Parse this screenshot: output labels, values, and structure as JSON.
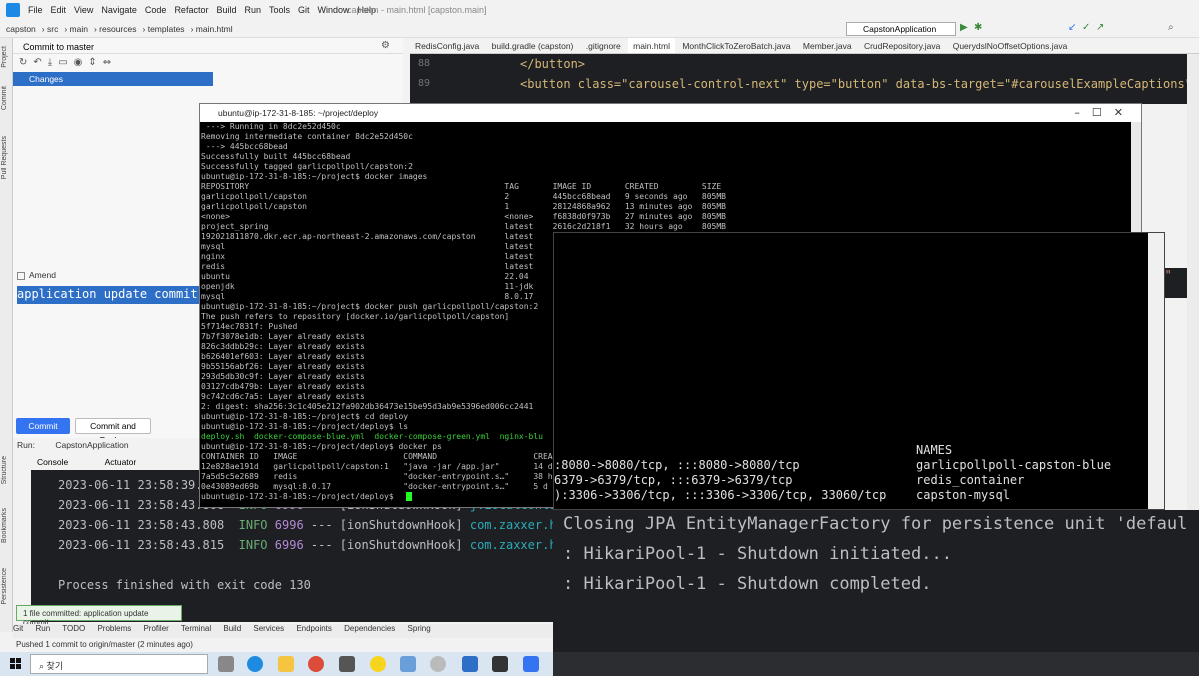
{
  "ide": {
    "menu": [
      "File",
      "Edit",
      "View",
      "Navigate",
      "Code",
      "Refactor",
      "Build",
      "Run",
      "Tools",
      "Git",
      "Window",
      "Help"
    ],
    "title": "capston - main.html [capston.main]",
    "breadcrumb": [
      "capston",
      "src",
      "main",
      "resources",
      "templates",
      "main.html"
    ],
    "run_config": "CapstonApplication",
    "commit_header": "Commit to master",
    "changes_label": "Changes",
    "amend_label": "Amend",
    "commit_message": "application update commit",
    "commit_button": "Commit",
    "commit_push_button": "Commit and Push...",
    "left_tools": [
      "Project",
      "Commit",
      "Pull Requests",
      "Structure",
      "Bookmarks",
      "Persistence"
    ],
    "tabs": [
      "RedisConfig.java",
      "build.gradle (capston)",
      ".gitignore",
      "main.html",
      "MonthClickToZeroBatch.java",
      "Member.java",
      "CrudRepository.java",
      "QuerydslNoOffsetOptions.java"
    ],
    "active_tab": "main.html",
    "editor_lines": [
      {
        "num": "88",
        "code": "</button>"
      },
      {
        "num": "89",
        "code": "<button class=\"carousel-control-next\" type=\"button\" data-bs-target=\"#carouselExampleCaptions\" dat"
      }
    ],
    "editor_right_fragment": "l}\"",
    "run_label": "Run:",
    "run_tab": "CapstonApplication",
    "console_tab": "Console",
    "actuator_tab": "Actuator",
    "console_lines": [
      {
        "ts": "2023-06-11 23:58:39.5",
        "level": "",
        "pid": "",
        "rest": ""
      },
      {
        "ts": "2023-06-11 23:58:43.806",
        "level": "INFO",
        "pid": "6996",
        "rest": " --- [ionShutdownHook] ",
        "cls": "j.LocalContaine"
      },
      {
        "ts": "2023-06-11 23:58:43.808",
        "level": "INFO",
        "pid": "6996",
        "rest": " --- [ionShutdownHook] ",
        "cls": "com.zaxxer.hika"
      },
      {
        "ts": "2023-06-11 23:58:43.815",
        "level": "INFO",
        "pid": "6996",
        "rest": " --- [ionShutdownHook] ",
        "cls": "com.zaxxer.hika"
      }
    ],
    "process_finished": "Process finished with exit code 130",
    "tool_tabs": [
      "Git",
      "Run",
      "TODO",
      "Problems",
      "Profiler",
      "Terminal",
      "Build",
      "Services",
      "Endpoints",
      "Dependencies",
      "Spring"
    ],
    "tooltip": "1 file committed: application update commit",
    "status": "Pushed 1 commit to origin/master (2 minutes ago)",
    "big_lines": [
      "Closing JPA EntityManagerFactory for persistence unit 'defaul",
      ": HikariPool-1 - Shutdown initiated...",
      ": HikariPool-1 - Shutdown completed."
    ]
  },
  "putty": {
    "title": "ubuntu@ip-172-31-8-185: ~/project/deploy",
    "lines": [
      " ---> Running in 8dc2e52d450c",
      "Removing intermediate container 8dc2e52d450c",
      " ---> 445bcc68bead",
      "Successfully built 445bcc68bead",
      "Successfully tagged garlicpollpoll/capston:2",
      "ubuntu@ip-172-31-8-185:~/project$ docker images",
      "REPOSITORY                                                     TAG       IMAGE ID       CREATED         SIZE",
      "garlicpollpoll/capston                                         2         445bcc68bead   9 seconds ago   805MB",
      "garlicpollpoll/capston                                         1         28124868a962   13 minutes ago  805MB",
      "<none>                                                         <none>    f6838d0f973b   27 minutes ago  805MB",
      "project_spring                                                 latest    2616c2d218f1   32 hours ago    805MB",
      "192021811870.dkr.ecr.ap-northeast-2.amazonaws.com/capston      latest    c",
      "mysql                                                          latest    c",
      "nginx                                                          latest    i",
      "redis                                                          latest    i",
      "ubuntu                                                         22.04     3",
      "openjdk                                                        11-jdk    c",
      "mysql                                                          8.0.17    i",
      "ubuntu@ip-172-31-8-185:~/project$ docker push garlicpollpoll/capston:2",
      "The push refers to repository [docker.io/garlicpollpoll/capston]",
      "5f714ec7831f: Pushed",
      "7b7f3078e1db: Layer already exists",
      "826c3ddbb29c: Layer already exists",
      "b626401ef603: Layer already exists",
      "9b55156abf26: Layer already exists",
      "293d5db30c9f: Layer already exists",
      "03127cdb479b: Layer already exists",
      "9c742cd6c7a5: Layer already exists",
      "2: digest: sha256:3c1c405e212fa902db36473e15be95d3ab9e5396ed006cc2441",
      "ubuntu@ip-172-31-8-185:~/project$ cd deploy",
      "ubuntu@ip-172-31-8-185:~/project/deploy$ ls",
      "deploy.sh  docker-compose-blue.yml  docker-compose-green.yml  nginx-blu",
      "ubuntu@ip-172-31-8-185:~/project/deploy$ docker ps",
      "CONTAINER ID   IMAGE                      COMMAND                    CREA",
      "12e828ae191d   garlicpollpoll/capston:1   \"java -jar /app.jar\"       14 d",
      "7a5d5c5e2689   redis                      \"docker-entrypoint.s…\"     38 h",
      "0e43089ed69b   mysql:8.0.17               \"docker-entrypoint.s…\"     5 d",
      "ubuntu@ip-172-31-8-185:~/project/deploy$ "
    ],
    "green_prefix": "deploy.sh"
  },
  "overlay": {
    "names_header": "NAMES",
    "rows": [
      {
        "ports": ":8080->8080/tcp, :::8080->8080/tcp",
        "name": "garlicpollpoll-capston-blue"
      },
      {
        "ports": "6379->6379/tcp, :::6379->6379/tcp",
        "name": "redis_container"
      },
      {
        "ports": "):3306->3306/tcp, :::3306->3306/tcp, 33060/tcp",
        "name": "capston-mysql"
      }
    ]
  },
  "taskbar": {
    "search_placeholder": "찾기"
  }
}
